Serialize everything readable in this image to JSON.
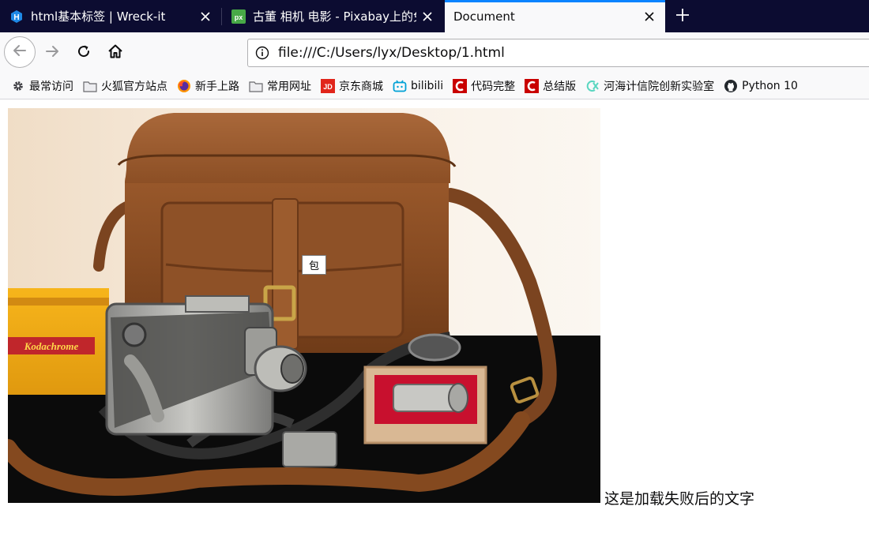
{
  "browser": {
    "tabs": [
      {
        "title": "html基本标签 | Wreck-it",
        "icon": "h-hexagon-icon",
        "active": false
      },
      {
        "title": "古董 相机 电影 - Pixabay上的免费",
        "icon": "pixabay-icon",
        "active": false
      },
      {
        "title": "Document",
        "icon": "",
        "active": true
      }
    ],
    "url": "file:///C:/Users/lyx/Desktop/1.html",
    "colors": {
      "tab_strip": "#0c0c31",
      "accent": "#0a84ff",
      "toolbar": "#f9f9fa"
    }
  },
  "bookmarks": [
    {
      "label": "最常访问",
      "icon": "gear-icon"
    },
    {
      "label": "火狐官方站点",
      "icon": "folder-icon"
    },
    {
      "label": "新手上路",
      "icon": "firefox-icon"
    },
    {
      "label": "常用网址",
      "icon": "folder-icon"
    },
    {
      "label": "京东商城",
      "icon": "jd-icon"
    },
    {
      "label": "bilibili",
      "icon": "bilibili-icon"
    },
    {
      "label": "代码完整",
      "icon": "csdn-icon"
    },
    {
      "label": "总结版",
      "icon": "csdn-icon"
    },
    {
      "label": "河海计信院创新实验室",
      "icon": "lab-icon"
    },
    {
      "label": "Python 10",
      "icon": "github-icon"
    }
  ],
  "page": {
    "image_title_tooltip": "包",
    "alt_text": "这是加载失败后的文字"
  }
}
